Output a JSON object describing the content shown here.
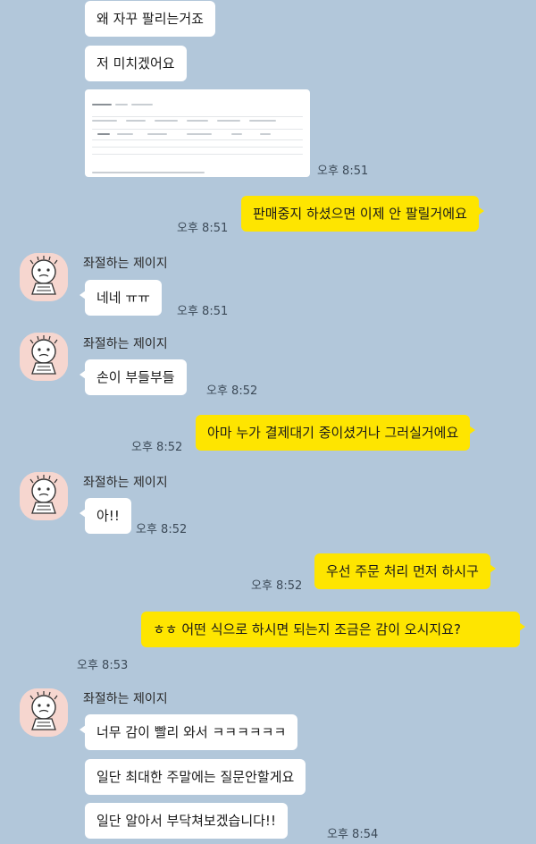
{
  "theme": {
    "background": "#b2c7da",
    "my_bubble": "#fee500",
    "their_bubble": "#ffffff"
  },
  "messages": {
    "m1": {
      "text": "왜 자꾸 팔리는거죠"
    },
    "m2": {
      "text": "저 미치겠어요"
    },
    "m3": {
      "time": "오후 8:51",
      "image": "screenshot-image"
    },
    "m4": {
      "text": "판매중지 하셨으면 이제 안 팔릴거에요",
      "time": "오후 8:51"
    },
    "g1": {
      "sender": "좌절하는 제이지",
      "text": "네네 ㅠㅠ",
      "time": "오후 8:51"
    },
    "g2": {
      "sender": "좌절하는 제이지",
      "text": "손이 부들부들",
      "time": "오후 8:52"
    },
    "m5": {
      "text": "아마 누가 결제대기 중이셨거나 그러실거에요",
      "time": "오후 8:52"
    },
    "g3": {
      "sender": "좌절하는 제이지",
      "text": "아!!",
      "time": "오후 8:52"
    },
    "m6": {
      "text": "우선 주문 처리 먼저 하시구",
      "time": "오후 8:52"
    },
    "m7": {
      "text": "ㅎㅎ 어떤 식으로 하시면 되는지 조금은 감이 오시지요?",
      "time": "오후 8:53"
    },
    "g4": {
      "sender": "좌절하는 제이지",
      "text": "너무 감이 빨리 와서 ㅋㅋㅋㅋㅋㅋ"
    },
    "g5": {
      "text": "일단 최대한 주말에는 질문안할게요"
    },
    "g6": {
      "text": "일단 알아서 부닥쳐보겠습니다!!",
      "time": "오후 8:54"
    }
  }
}
